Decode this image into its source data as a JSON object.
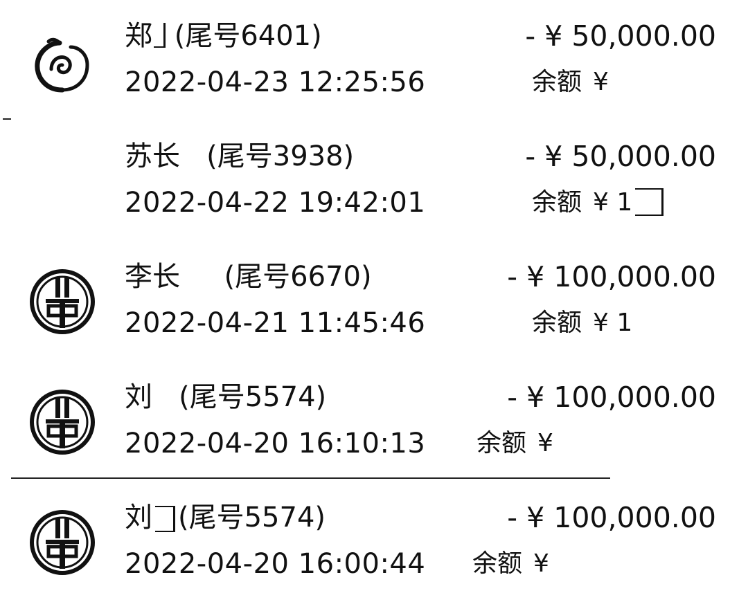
{
  "transactions": [
    {
      "icon": "swirl-logo-icon",
      "name": "郑",
      "tail": "(尾号6401)",
      "amount": "- ¥ 50,000.00",
      "time": "2022-04-23 12:25:56",
      "balance_label": "余额",
      "balance_value": "¥"
    },
    {
      "icon": "none",
      "name": "苏长",
      "tail": "(尾号3938)",
      "amount": "- ¥ 50,000.00",
      "time": "2022-04-22 19:42:01",
      "balance_label": "余额",
      "balance_value": "¥ 1"
    },
    {
      "icon": "abc-bank-logo-icon",
      "name": "李长",
      "tail": "(尾号6670)",
      "amount": "- ¥ 100,000.00",
      "time": "2022-04-21 11:45:46",
      "balance_label": "余额",
      "balance_value": "¥ 1"
    },
    {
      "icon": "abc-bank-logo-icon",
      "name": "刘",
      "tail": "(尾号5574)",
      "amount": "- ¥ 100,000.00",
      "time": "2022-04-20 16:10:13",
      "balance_label": "余额",
      "balance_value": "¥"
    },
    {
      "icon": "abc-bank-logo-icon",
      "name": "刘",
      "tail": "(尾号5574)",
      "amount": "- ¥ 100,000.00",
      "time": "2022-04-20 16:00:44",
      "balance_label": "余额",
      "balance_value": "¥"
    }
  ]
}
